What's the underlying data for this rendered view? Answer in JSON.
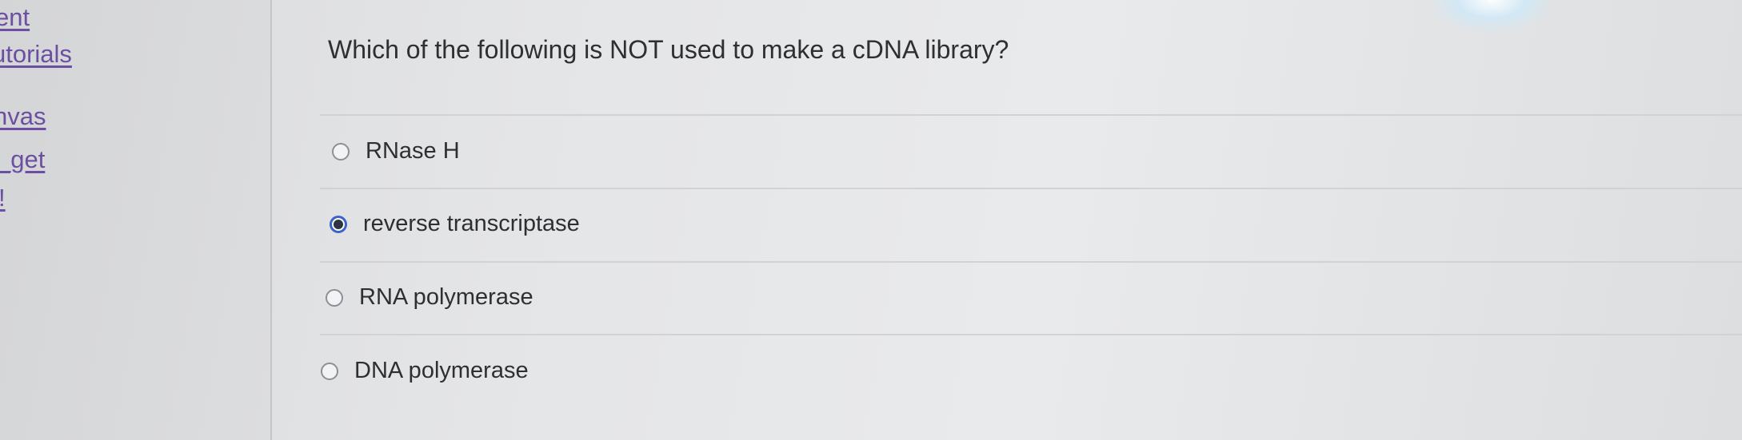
{
  "sidebar": {
    "items": [
      {
        "label": "ent"
      },
      {
        "label": "utorials"
      },
      {
        "label": "nvas"
      },
      {
        "label": "_get"
      },
      {
        "label": "!"
      }
    ]
  },
  "question": {
    "text": "Which of the following is NOT used to make a cDNA library?"
  },
  "answers": [
    {
      "label": "RNase H",
      "selected": false
    },
    {
      "label": "reverse transcriptase",
      "selected": true
    },
    {
      "label": "RNA polymerase",
      "selected": false
    },
    {
      "label": "DNA polymerase",
      "selected": false
    }
  ],
  "colors": {
    "link": "#6b4fa0",
    "radio_selected": "#3d63c9",
    "text": "#2d2f33"
  }
}
